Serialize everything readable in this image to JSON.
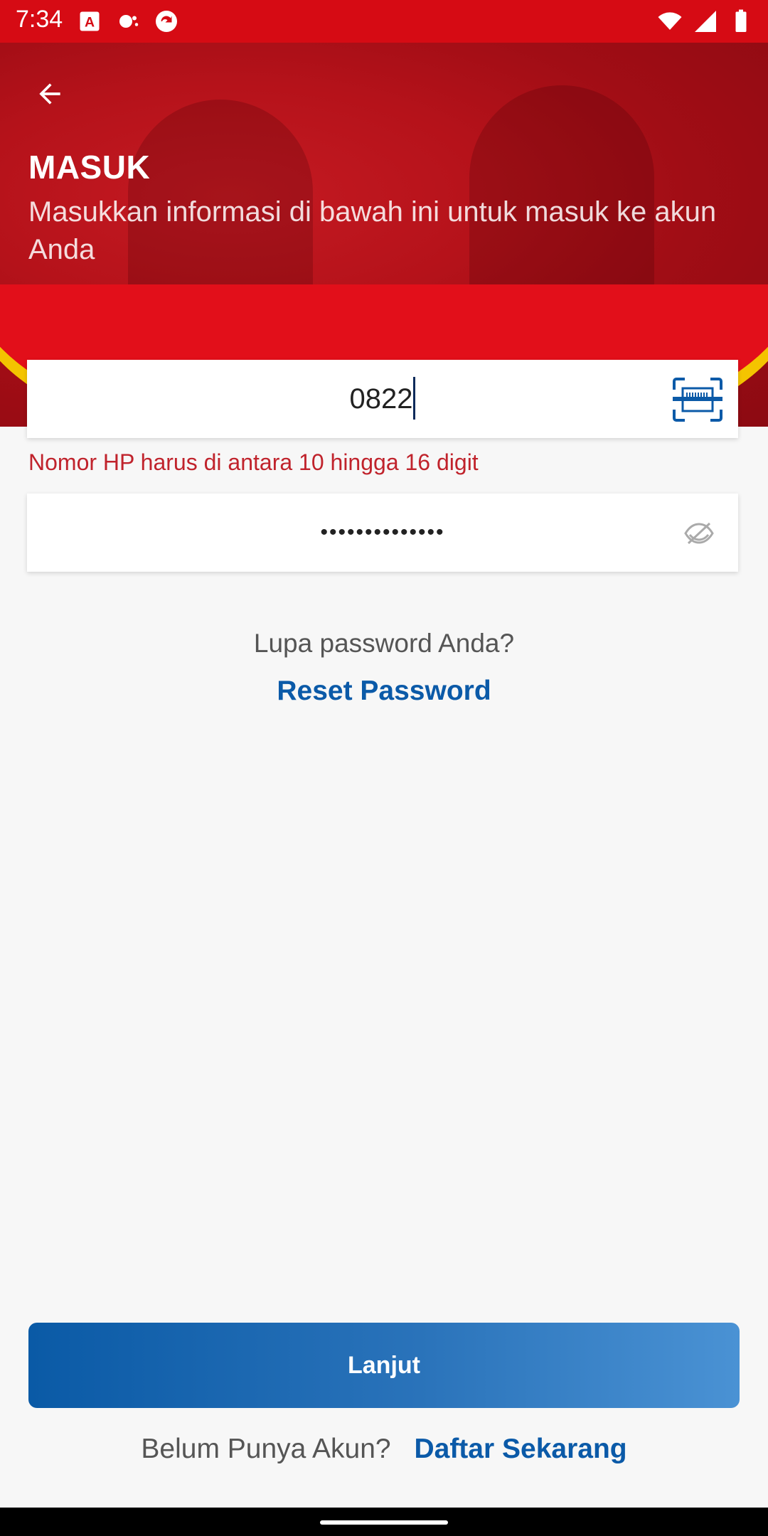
{
  "status_bar": {
    "time": "7:34",
    "icons_left": [
      "app-a-icon",
      "weather-icon",
      "sync-icon"
    ],
    "icons_right": [
      "wifi-icon",
      "signal-icon",
      "battery-icon"
    ]
  },
  "header": {
    "title": "MASUK",
    "subtitle": "Masukkan informasi di bawah ini untuk masuk ke akun Anda",
    "colors": {
      "primary": "#d60b14",
      "accent": "#f4c400"
    }
  },
  "phone_field": {
    "value": "0822",
    "icon": "scan-icon",
    "error": "Nomor HP harus di antara 10 hingga 16 digit"
  },
  "password_field": {
    "value": "••••••••••••••",
    "icon": "eye-off-icon"
  },
  "forgot": {
    "question": "Lupa password Anda?",
    "link": "Reset Password"
  },
  "submit": {
    "label": "Lanjut"
  },
  "signup": {
    "question": "Belum Punya Akun?",
    "link": "Daftar Sekarang"
  },
  "colors": {
    "link": "#0b5aa8",
    "error": "#c0232c",
    "button_start": "#0a5aa6",
    "button_end": "#4a92d4"
  }
}
